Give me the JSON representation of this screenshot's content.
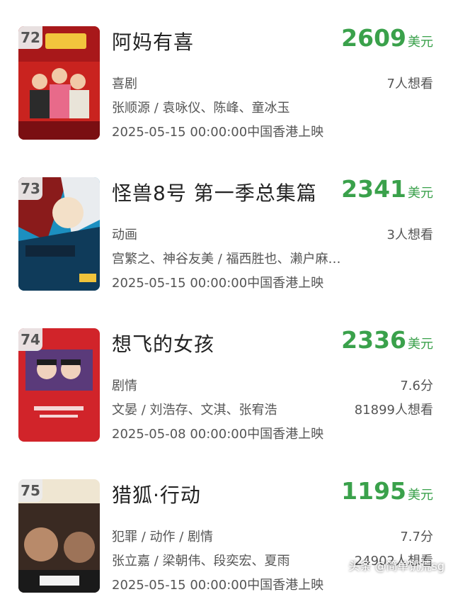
{
  "colors": {
    "accent_green": "#3aa14b",
    "text": "#333333",
    "secondary": "#555555"
  },
  "movies": [
    {
      "rank": "72",
      "title": "阿妈有喜",
      "box_office": "2609",
      "box_unit": "美元",
      "genre": "喜剧",
      "rating": "7人想看",
      "cast": "张顺源 / 袁咏仪、陈峰、童冰玉",
      "want": "",
      "release": "2025-05-15 00:00:00中国香港上映"
    },
    {
      "rank": "73",
      "title": "怪兽8号 第一季总集篇",
      "box_office": "2341",
      "box_unit": "美元",
      "genre": "动画",
      "rating": "3人想看",
      "cast": "宫繁之、神谷友美 / 福西胜也、濑户麻沙美、加藤涉",
      "want": "",
      "release": "2025-05-15 00:00:00中国香港上映"
    },
    {
      "rank": "74",
      "title": "想飞的女孩",
      "box_office": "2336",
      "box_unit": "美元",
      "genre": "剧情",
      "rating": "7.6分",
      "cast": "文晏 / 刘浩存、文淇、张宥浩",
      "want": "81899人想看",
      "release": "2025-05-08 00:00:00中国香港上映"
    },
    {
      "rank": "75",
      "title": "猎狐·行动",
      "box_office": "1195",
      "box_unit": "美元",
      "genre": "犯罪 / 动作 / 剧情",
      "rating": "7.7分",
      "cast": "张立嘉 / 梁朝伟、段奕宏、夏雨",
      "want": "24902人想看",
      "release": "2025-05-15 00:00:00中国香港上映"
    }
  ],
  "watermark": "头条 @简单饥荒sg"
}
